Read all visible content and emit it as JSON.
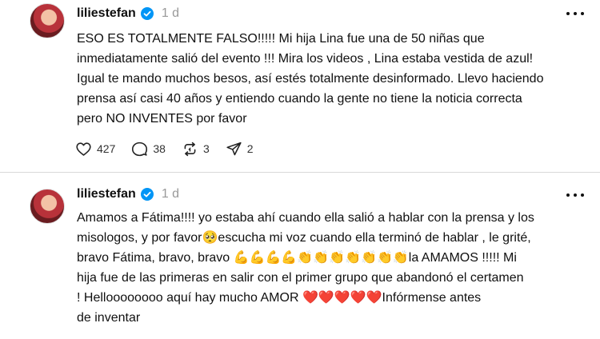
{
  "posts": [
    {
      "username": "liliestefan",
      "time": "1 d",
      "lines": [
        "ESO ES TOTALMENTE FALSO!!!!! Mi hija Lina fue una de 50 niñas que",
        "inmediatamente salió del evento !!! Mira los videos , Lina estaba vestida de azul!",
        "Igual te mando muchos besos, así estés totalmente desinformado. Llevo haciendo",
        "prensa así casi 40 años y entiendo cuando la gente no tiene la noticia correcta",
        "pero NO INVENTES por favor"
      ],
      "likes": "427",
      "comments": "38",
      "reposts": "3",
      "shares": "2"
    },
    {
      "username": "liliestefan",
      "time": "1 d",
      "lines": [
        "Amamos a Fátima!!!! yo estaba ahí cuando ella salió a hablar con la prensa y los",
        "misologos, y por favor🥺escucha mi voz cuando ella terminó de hablar , le grité,",
        "bravo Fátima, bravo, bravo 💪💪💪💪👏👏👏👏👏👏👏la AMAMOS !!!!! Mi",
        "hija fue de las primeras en salir con el primer grupo que abandonó el certamen",
        "! Helloooooooo aquí hay mucho AMOR ❤️❤️❤️❤️❤️Infórmense antes",
        "de inventar"
      ]
    }
  ],
  "icons": {
    "verified": "verified-badge-icon",
    "more": "more-options-icon",
    "like": "heart-icon",
    "comment": "comment-icon",
    "repost": "repost-icon",
    "share": "share-icon"
  },
  "colors": {
    "verified": "#0095f6",
    "muted": "#999999",
    "text": "#101010"
  }
}
